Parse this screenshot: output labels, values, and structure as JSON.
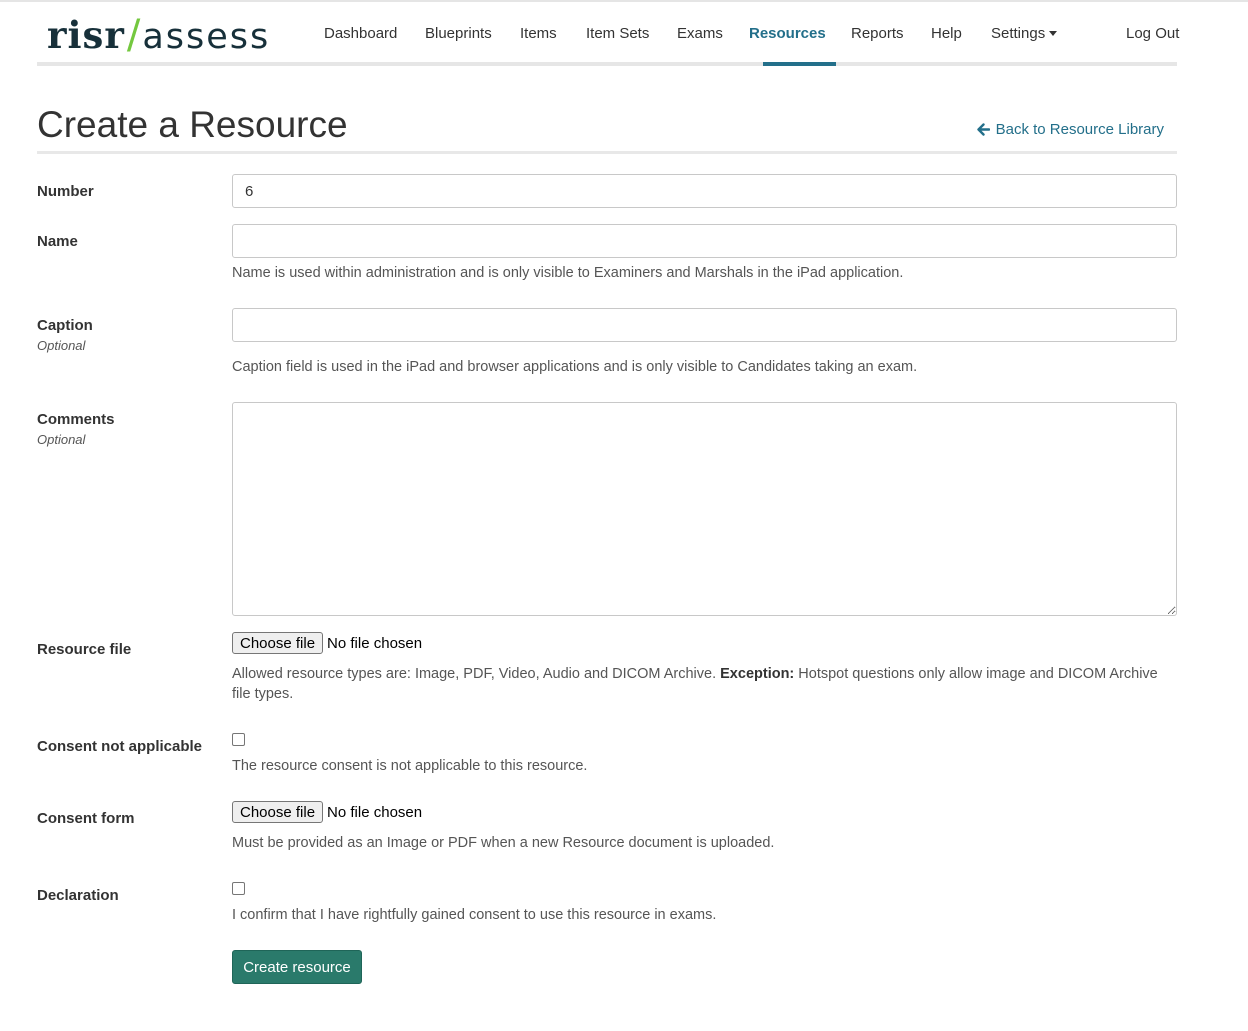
{
  "brand": {
    "part1": "risr",
    "separator": "/",
    "part2": "assess",
    "accent_color": "#74c83f",
    "dark_color": "#17303a"
  },
  "nav": {
    "items": [
      {
        "label": "Dashboard"
      },
      {
        "label": "Blueprints"
      },
      {
        "label": "Items"
      },
      {
        "label": "Item Sets"
      },
      {
        "label": "Exams"
      },
      {
        "label": "Resources",
        "active": true
      },
      {
        "label": "Reports"
      },
      {
        "label": "Help"
      },
      {
        "label": "Settings",
        "has_dropdown": true
      }
    ],
    "logout": "Log Out",
    "active_color": "#236f8a"
  },
  "page": {
    "title": "Create a Resource",
    "back_link": "Back to Resource Library",
    "back_icon": "arrow-left-icon"
  },
  "form": {
    "number": {
      "label": "Number",
      "value": "6"
    },
    "name": {
      "label": "Name",
      "value": "",
      "help": "Name is used within administration and is only visible to Examiners and Marshals in the iPad application."
    },
    "caption": {
      "label": "Caption",
      "optional": "Optional",
      "value": "",
      "help": "Caption field is used in the iPad and browser applications and is only visible to Candidates taking an exam."
    },
    "comments": {
      "label": "Comments",
      "optional": "Optional",
      "value": ""
    },
    "resource_file": {
      "label": "Resource file",
      "button": "Choose file",
      "status": "No file chosen",
      "help_prefix": "Allowed resource types are: Image, PDF, Video, Audio and DICOM Archive.",
      "help_bold": "Exception:",
      "help_suffix": "Hotspot questions only allow image and DICOM Archive file types."
    },
    "consent_not_applicable": {
      "label": "Consent not applicable",
      "checked": false,
      "help": "The resource consent is not applicable to this resource."
    },
    "consent_form": {
      "label": "Consent form",
      "button": "Choose file",
      "status": "No file chosen",
      "help": "Must be provided as an Image or PDF when a new Resource document is uploaded."
    },
    "declaration": {
      "label": "Declaration",
      "checked": false,
      "help": "I confirm that I have rightfully gained consent to use this resource in exams."
    },
    "submit": "Create resource",
    "submit_color": "#2a7a6b"
  }
}
